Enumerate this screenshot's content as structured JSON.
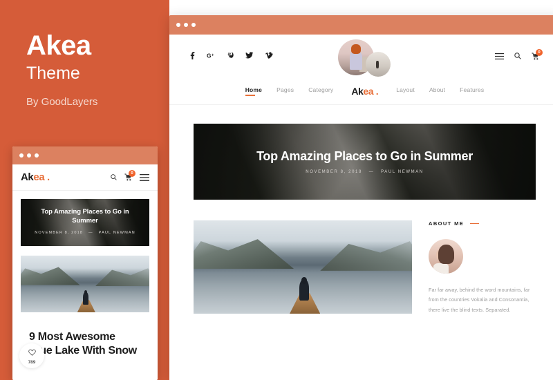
{
  "promo": {
    "title": "Akea",
    "subtitle": "Theme",
    "byline": "By GoodLayers"
  },
  "colors": {
    "panel_orange": "#d55c39",
    "titlebar_orange": "#dc8160",
    "accent_orange": "#e8703a",
    "badge_orange": "#f0632b"
  },
  "mobile": {
    "logo": {
      "part1": "Ak",
      "part2": "ea",
      "dot": "."
    },
    "header_icons": [
      {
        "name": "search-icon",
        "label": "Search"
      },
      {
        "name": "cart-icon",
        "label": "Cart",
        "badge": "0"
      },
      {
        "name": "hamburger-menu-icon",
        "label": "Menu"
      }
    ],
    "hero": {
      "title": "Top Amazing Places to Go in Summer",
      "date": "NOVEMBER 8, 2018",
      "separator": "—",
      "author": "PAUL NEWMAN"
    },
    "post": {
      "like_icon": "heart-icon",
      "like_count": "789",
      "title": "9 Most Awesome Blue Lake With Snow"
    }
  },
  "desktop": {
    "social": [
      {
        "name": "facebook-icon",
        "glyph": "f"
      },
      {
        "name": "google-plus-icon",
        "glyph": "G+"
      },
      {
        "name": "pinterest-icon",
        "glyph": "P"
      },
      {
        "name": "twitter-icon",
        "glyph": ""
      },
      {
        "name": "vimeo-icon",
        "glyph": "v"
      }
    ],
    "right_icons": [
      {
        "name": "hamburger-menu-icon",
        "label": "Menu"
      },
      {
        "name": "search-icon",
        "label": "Search"
      },
      {
        "name": "cart-icon",
        "label": "Cart",
        "badge": "0"
      }
    ],
    "nav_left": [
      {
        "label": "Home",
        "active": true
      },
      {
        "label": "Pages",
        "active": false
      },
      {
        "label": "Category",
        "active": false
      }
    ],
    "logo": {
      "part1": "Ak",
      "part2": "ea",
      "dot": "."
    },
    "nav_right": [
      {
        "label": "Layout",
        "active": false
      },
      {
        "label": "About",
        "active": false
      },
      {
        "label": "Features",
        "active": false
      }
    ],
    "hero": {
      "title": "Top Amazing Places to Go in Summer",
      "date": "NOVEMBER 8, 2018",
      "separator": "—",
      "author": "PAUL NEWMAN",
      "prev_arrow": "‹",
      "next_arrow": "›"
    },
    "sidebar": {
      "about_heading": "ABOUT ME",
      "about_text": "Far far away, behind the word mountains, far from the countries Vokalia and Consonantia, there live the blind texts. Separated."
    }
  }
}
